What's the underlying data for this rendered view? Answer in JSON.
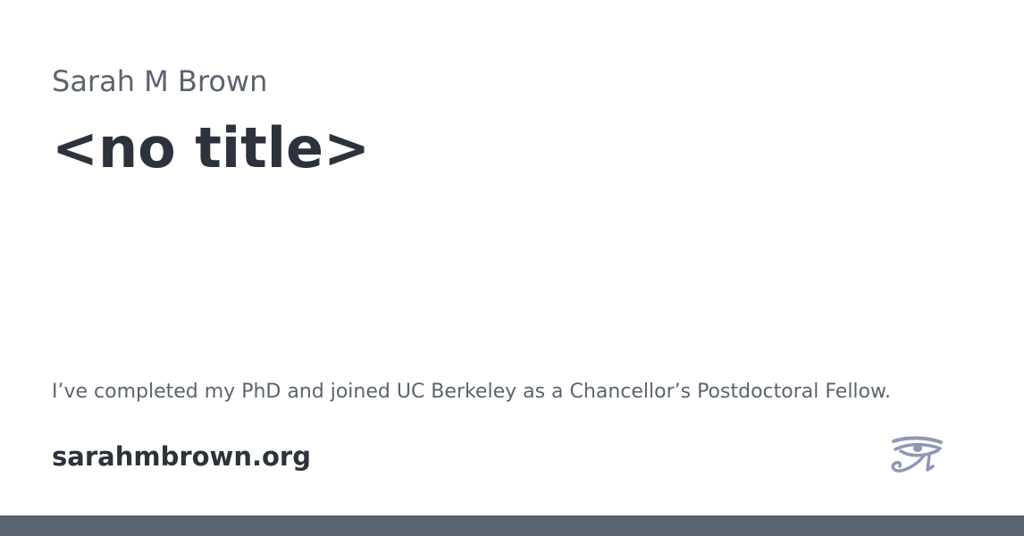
{
  "card": {
    "author": "Sarah M Brown",
    "title": "<no title>",
    "description": "I’ve completed my PhD and joined UC Berkeley as a Chancellor’s Postdoctoral Fellow.",
    "site_url": "sarahmbrown.org",
    "logo_icon": "eye-of-horus-icon"
  },
  "colors": {
    "primary_text": "#2c333c",
    "secondary_text": "#5c6370",
    "logo": "#8e97b5",
    "footer_bar": "#5c6370",
    "background": "#ffffff"
  }
}
